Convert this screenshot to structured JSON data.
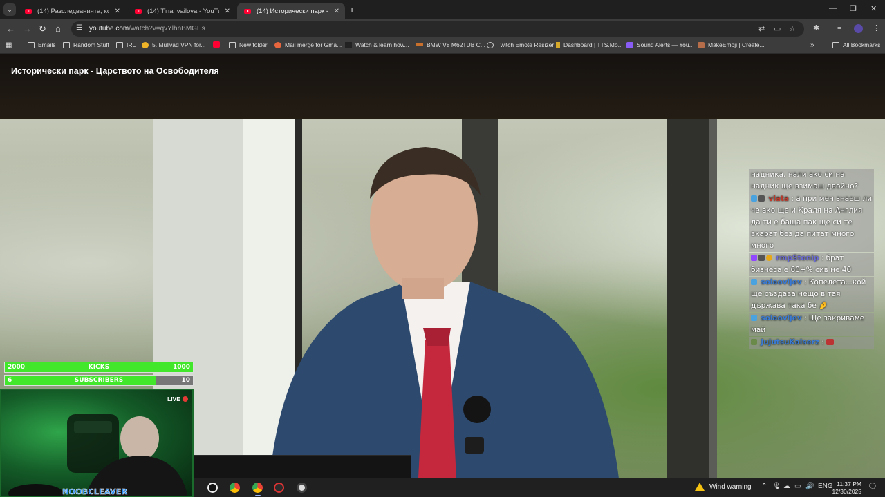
{
  "browser": {
    "tabs": [
      {
        "title": "(14) Разследванията, които бе...",
        "active": false
      },
      {
        "title": "(14) Tina Ivailova - YouTube",
        "active": false
      },
      {
        "title": "(14) Исторически парк - Царс...",
        "active": true
      }
    ],
    "url_host": "youtube.com",
    "url_path": "/watch?v=qvYlhnBMGEs",
    "bookmarks": [
      {
        "label": "Emails",
        "icon": "folder-icon"
      },
      {
        "label": "Random Stuff",
        "icon": "folder-icon"
      },
      {
        "label": "IRL",
        "icon": "folder-icon"
      },
      {
        "label": "5. Mullvad VPN for...",
        "icon": "mullvad-icon"
      },
      {
        "label": "",
        "icon": "youtube-icon"
      },
      {
        "label": "New folder",
        "icon": "folder-icon"
      },
      {
        "label": "Mail merge for Gma...",
        "icon": "mail-merge-icon"
      },
      {
        "label": "Watch & learn how...",
        "icon": "tv-icon"
      },
      {
        "label": "BMW V8 M62TUB C...",
        "icon": "car-icon"
      },
      {
        "label": "Twitch Emote Resizer",
        "icon": "globe-icon"
      },
      {
        "label": "Dashboard | TTS.Mo...",
        "icon": "dashboard-icon"
      },
      {
        "label": "Sound Alerts — You...",
        "icon": "sound-alerts-icon"
      },
      {
        "label": "MakeEmoji | Create...",
        "icon": "makeemoji-icon"
      }
    ],
    "all_bookmarks": "All Bookmarks"
  },
  "video": {
    "title": "Исторически парк - Царството на Освободителя"
  },
  "chat": [
    {
      "user": "",
      "user_color": "#ffffff",
      "text": "надника, нали ако си на надник ще взимаш двойно?"
    },
    {
      "user": "vlata",
      "user_color": "#c0392b",
      "text": ": а при мен знаеш ли че ако ще и Краля на Англия да ти е баща пак ще си те вкарат без да питат много много"
    },
    {
      "user": "rmpStonip",
      "user_color": "#6b6bd6",
      "text": ": брат бизнеса е 60+% сив не 40"
    },
    {
      "user": "solaovljev",
      "user_color": "#3a7bd5",
      "text": ": Копелета...кой ще създава нещо в тая държава така бе"
    },
    {
      "user": "solaovljev",
      "user_color": "#3a7bd5",
      "text": ": Ще закриваме май"
    },
    {
      "user": "JujutsuKaiserz",
      "user_color": "#3a7bd5",
      "text": ":"
    }
  ],
  "goals": {
    "kicks": {
      "left": "2000",
      "label": "KICKS",
      "right": "1000",
      "fill_fraction": 1.0
    },
    "subscribers": {
      "left": "6",
      "label": "SUBSCRIBERS",
      "right": "10",
      "fill_fraction": 0.8
    }
  },
  "webcam": {
    "live_label": "LIVE",
    "streamer": "NOOBCLEAVER"
  },
  "taskbar": {
    "weather": "Wind warning",
    "language": "ENG",
    "time": "11:37 PM",
    "date": "12/30/2025"
  }
}
